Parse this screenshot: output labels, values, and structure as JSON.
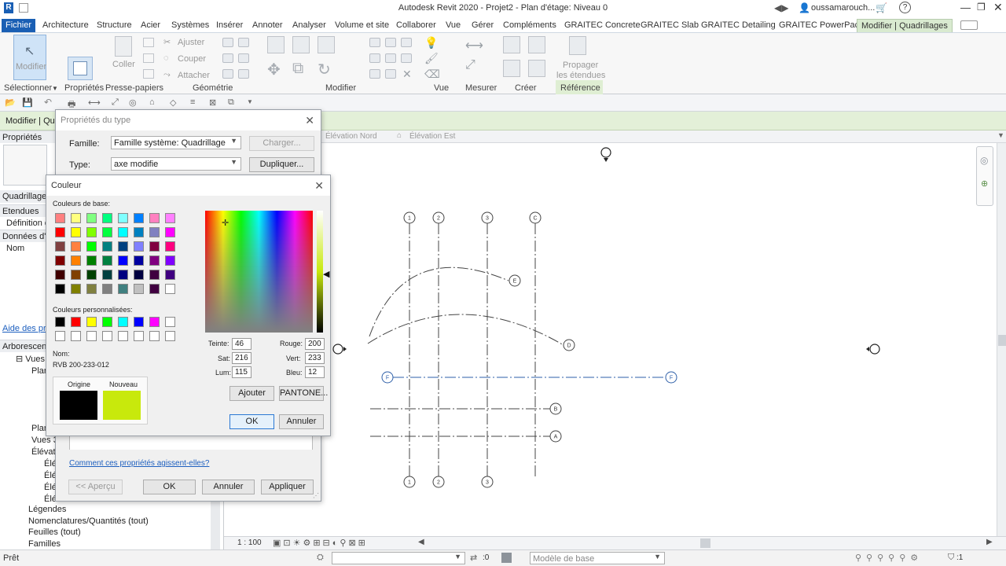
{
  "window": {
    "title": "Autodesk Revit 2020 - Projet2 - Plan d'étage: Niveau 0",
    "user": "oussamarouch..."
  },
  "tabs": [
    "Fichier",
    "Architecture",
    "Structure",
    "Acier",
    "Systèmes",
    "Insérer",
    "Annoter",
    "Analyser",
    "Volume et site",
    "Collaborer",
    "Vue",
    "Gérer",
    "Compléments",
    "GRAITEC Concrete",
    "GRAITEC Slab",
    "GRAITEC Detailing",
    "GRAITEC PowerPack",
    "Modifier | Quadrillages"
  ],
  "ribbon": {
    "modifier": "Modifier",
    "coller": "Coller",
    "ajuster": "Ajuster",
    "couper": "Couper",
    "attacher": "Attacher",
    "propager": "Propager",
    "etendues": "les étendues",
    "groups": {
      "selectionner": "Sélectionner",
      "proprietes": "Propriétés",
      "presse_papiers": "Presse-papiers",
      "geometrie": "Géométrie",
      "modifier": "Modifier",
      "vue": "Vue",
      "mesurer": "Mesurer",
      "creer": "Créer",
      "reference": "Référence"
    }
  },
  "ctxbar": {
    "label": "Modifier | Qua"
  },
  "left_panel": {
    "proprietes": "Propriétés",
    "quadrillages": "Quadrillages",
    "etendues": "Etendues",
    "definition": "Définition d",
    "donnees": "Données d'i",
    "nom": "Nom",
    "aide": "Aide des pro",
    "browser": "Arborescenc",
    "tree": {
      "vues": "Vues",
      "plan": "Plan",
      "plan2": "Plan",
      "vues3": "Vues 3",
      "elevations": "Élévati",
      "elev1": "Élé",
      "elev2": "Élé",
      "elev3": "Élé",
      "elev4": "Élé",
      "legendes": "Légendes",
      "nomenclatures": "Nomenclatures/Quantités (tout)",
      "feuilles": "Feuilles (tout)",
      "familles": "Familles"
    }
  },
  "view_tabs": {
    "nord": "Élévation Nord",
    "est": "Élévation Est"
  },
  "type_dialog": {
    "title": "Propriétés du type",
    "famille_label": "Famille:",
    "famille_value": "Famille système: Quadrillage",
    "type_label": "Type:",
    "type_value": "axe modifie",
    "charger": "Charger...",
    "dupliquer": "Dupliquer...",
    "help_link": "Comment ces propriétés agissent-elles?",
    "apercu": "<< Aperçu",
    "ok": "OK",
    "annuler": "Annuler",
    "appliquer": "Appliquer"
  },
  "color_dialog": {
    "title": "Couleur",
    "base_label": "Couleurs de base:",
    "custom_label": "Couleurs personnalisées:",
    "nom_label": "Nom:",
    "nom_value": "RVB 200-233-012",
    "origine": "Origine",
    "nouveau": "Nouveau",
    "teinte_label": "Teinte:",
    "teinte": "46",
    "sat_label": "Sat:",
    "sat": "216",
    "lum_label": "Lum:",
    "lum": "115",
    "rouge_label": "Rouge:",
    "rouge": "200",
    "vert_label": "Vert:",
    "vert": "233",
    "bleu_label": "Bleu:",
    "bleu": "12",
    "ajouter": "Ajouter",
    "pantone": "PANTONE...",
    "ok": "OK",
    "annuler": "Annuler",
    "origin_color": "#000000",
    "new_color": "#c8e90c",
    "base_colors": [
      "#ff8080",
      "#ffff80",
      "#80ff80",
      "#00ff80",
      "#80ffff",
      "#0080ff",
      "#ff80c0",
      "#ff80ff",
      "#ff0000",
      "#ffff00",
      "#80ff00",
      "#00ff40",
      "#00ffff",
      "#0080c0",
      "#8080c0",
      "#ff00ff",
      "#804040",
      "#ff8040",
      "#00ff00",
      "#008080",
      "#004080",
      "#8080ff",
      "#800040",
      "#ff0080",
      "#800000",
      "#ff8000",
      "#008000",
      "#008040",
      "#0000ff",
      "#0000a0",
      "#800080",
      "#8000ff",
      "#400000",
      "#804000",
      "#004000",
      "#004040",
      "#000080",
      "#000040",
      "#400040",
      "#400080",
      "#000000",
      "#808000",
      "#808040",
      "#808080",
      "#408080",
      "#c0c0c0",
      "#400040",
      "#ffffff"
    ],
    "custom_colors": [
      "#000000",
      "#ff0000",
      "#ffff00",
      "#00ff00",
      "#00ffff",
      "#0000ff",
      "#ff00ff",
      "#ffffff",
      "#ffffff",
      "#ffffff",
      "#ffffff",
      "#ffffff",
      "#ffffff",
      "#ffffff",
      "#ffffff",
      "#ffffff"
    ]
  },
  "grid": {
    "top_labels": [
      "1",
      "2",
      "3",
      "C"
    ],
    "bottom_labels": [
      "1",
      "2",
      "3"
    ],
    "side_labels": [
      "E",
      "D",
      "F",
      "F",
      "B",
      "A"
    ]
  },
  "view_control": {
    "scale": "1 : 100"
  },
  "status": {
    "text": "Prêt",
    "counter": ":0",
    "model": "Modèle de base",
    "filter": ":1"
  }
}
